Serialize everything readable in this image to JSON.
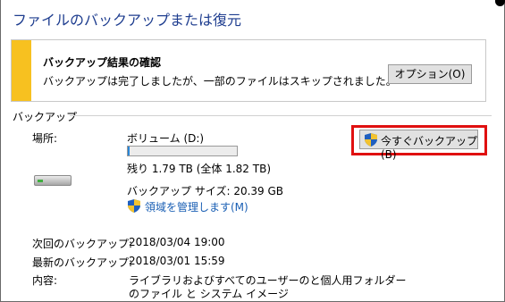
{
  "title": "ファイルのバックアップまたは復元",
  "status": {
    "heading": "バックアップ結果の確認",
    "message": "バックアップは完了しましたが、一部のファイルはスキップされました。",
    "options_button": "オプション(O)",
    "accent_color": "#f7c120"
  },
  "backup": {
    "section_label": "バックアップ",
    "location_label": "場所:",
    "volume": "ボリューム (D:)",
    "usage_fraction": 0.017,
    "free_space": "残り 1.79 TB (全体 1.82 TB)",
    "backup_size": "バックアップ サイズ: 20.39 GB",
    "manage_space_link": "領域を管理します(M)",
    "backup_now_button": "今すぐバックアップ(B)",
    "highlight_color": "#e01010"
  },
  "schedule": {
    "next_label": "次回のバックアップ:",
    "next_value": "2018/03/04 19:00",
    "last_label": "最新のバックアップ:",
    "last_value": "2018/03/01 15:59",
    "contents_label": "内容:",
    "contents_line1": "ライブラリおよびすべてのユーザーのと個人用フォルダー",
    "contents_line2": "のファイル と システム イメージ"
  },
  "icons": {
    "drive": "hard-drive-icon",
    "shield": "uac-shield-icon"
  }
}
